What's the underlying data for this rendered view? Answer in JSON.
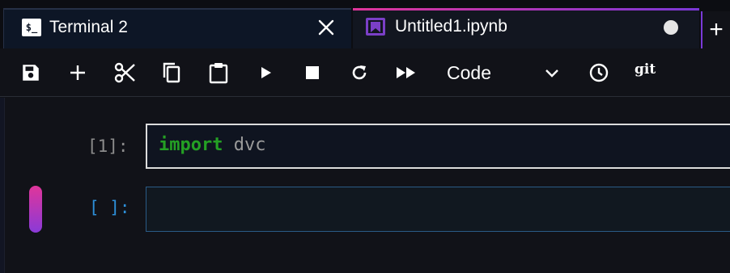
{
  "tabs": [
    {
      "label": "Terminal 2",
      "icon": "terminal-icon",
      "icon_text": "$_",
      "active": false
    },
    {
      "label": "Untitled1.ipynb",
      "icon": "notebook-icon",
      "active": true,
      "unsaved": true
    }
  ],
  "toolbar": {
    "buttons": [
      "save-icon",
      "add-icon",
      "cut-icon",
      "copy-icon",
      "paste-icon",
      "run-icon",
      "stop-icon",
      "restart-icon",
      "run-all-icon"
    ],
    "cell_type": "Code",
    "history_icon": "clock-icon",
    "git_label": "git"
  },
  "cells": [
    {
      "prompt": "[1]:",
      "code": {
        "keyword": "import",
        "name": "dvc"
      },
      "selected": true
    },
    {
      "prompt": "[ ]:",
      "code": {
        "keyword": "",
        "name": ""
      },
      "active": true
    }
  ],
  "colors": {
    "accent_pink": "#e0359a",
    "accent_purple": "#7a37d6",
    "keyword_green": "#24a024",
    "prompt_blue": "#2d8fd8"
  }
}
